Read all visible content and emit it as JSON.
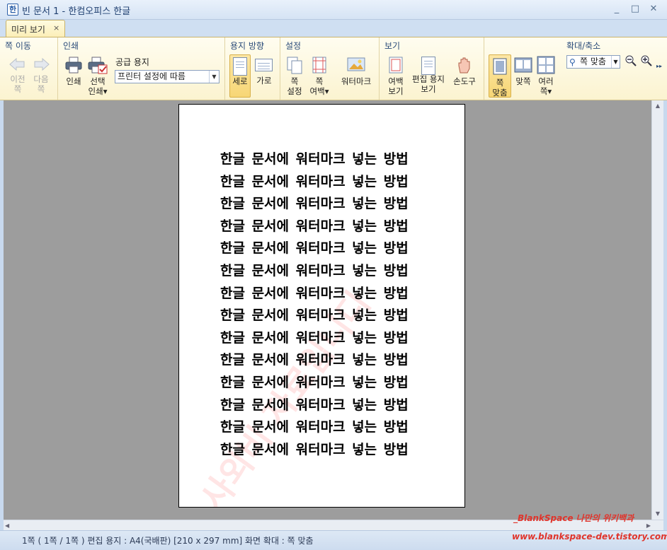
{
  "window": {
    "title": "빈 문서 1 - 한컴오피스 한글",
    "app_icon": "hwp-app-icon",
    "min": "▭",
    "max": "□",
    "close": "✕"
  },
  "tab": {
    "label": "미리 보기",
    "close": "×"
  },
  "ribbon": {
    "nav": {
      "title": "쪽 이동",
      "prev": "이전\n쪽",
      "next": "다음\n쪽"
    },
    "print": {
      "title": "인쇄",
      "print_btn": "인쇄",
      "select_print": "선택\n인쇄▾",
      "paper_label": "공급 용지",
      "paper_value": "프린터 설정에 따름"
    },
    "orientation": {
      "title": "용지 방향",
      "portrait": "세로",
      "landscape": "가로"
    },
    "settings": {
      "title": "설정",
      "page_setup": "쪽\n설정",
      "page_margin": "쪽\n여백▾",
      "watermark": "워터마크"
    },
    "view": {
      "title": "보기",
      "margin_view": "여백\n보기",
      "edit_paper_view": "편집 용지\n보기",
      "hand_tool": "손도구"
    },
    "zoom": {
      "title": "확대/축소",
      "fit_page": "쪽\n맞춤",
      "fit_width": "맞쪽",
      "multi_page": "여러\n쪽▾",
      "select_value": "쪽 맞춤",
      "zoom_out": "−",
      "zoom_in": "+",
      "more": "▸▸"
    }
  },
  "document": {
    "lines": [
      "한글 문서에 워터마크 넣는 방법",
      "한글 문서에 워터마크 넣는 방법",
      "한글 문서에 워터마크 넣는 방법",
      "한글 문서에 워터마크 넣는 방법",
      "한글 문서에 워터마크 넣는 방법",
      "한글 문서에 워터마크 넣는 방법",
      "한글 문서에 워터마크 넣는 방법",
      "한글 문서에 워터마크 넣는 방법",
      "한글 문서에 워터마크 넣는 방법",
      "한글 문서에 워터마크 넣는 방법",
      "한글 문서에 워터마크 넣는 방법",
      "한글 문서에 워터마크 넣는 방법",
      "한글 문서에 워터마크 넣는 방법",
      "한글 문서에 워터마크 넣는 방법"
    ],
    "watermark_text": "사외비 자료입니다"
  },
  "status": {
    "text": "1쪽 ( 1쪽 / 1쪽 ) 편집 용지 : A4(국배판)  [210 x 297 mm]  화면 확대 : 쪽 맞춤"
  },
  "overlay": {
    "credit_line1": "_BlankSpace 나만의 위키백과",
    "credit_line2": "www.blankspace-dev.tistory.com"
  },
  "colors": {
    "ribbon_bg": "#fbf3d0",
    "accent": "#2b5fa8",
    "credit": "#e0342b",
    "workspace": "#9d9d9d"
  }
}
